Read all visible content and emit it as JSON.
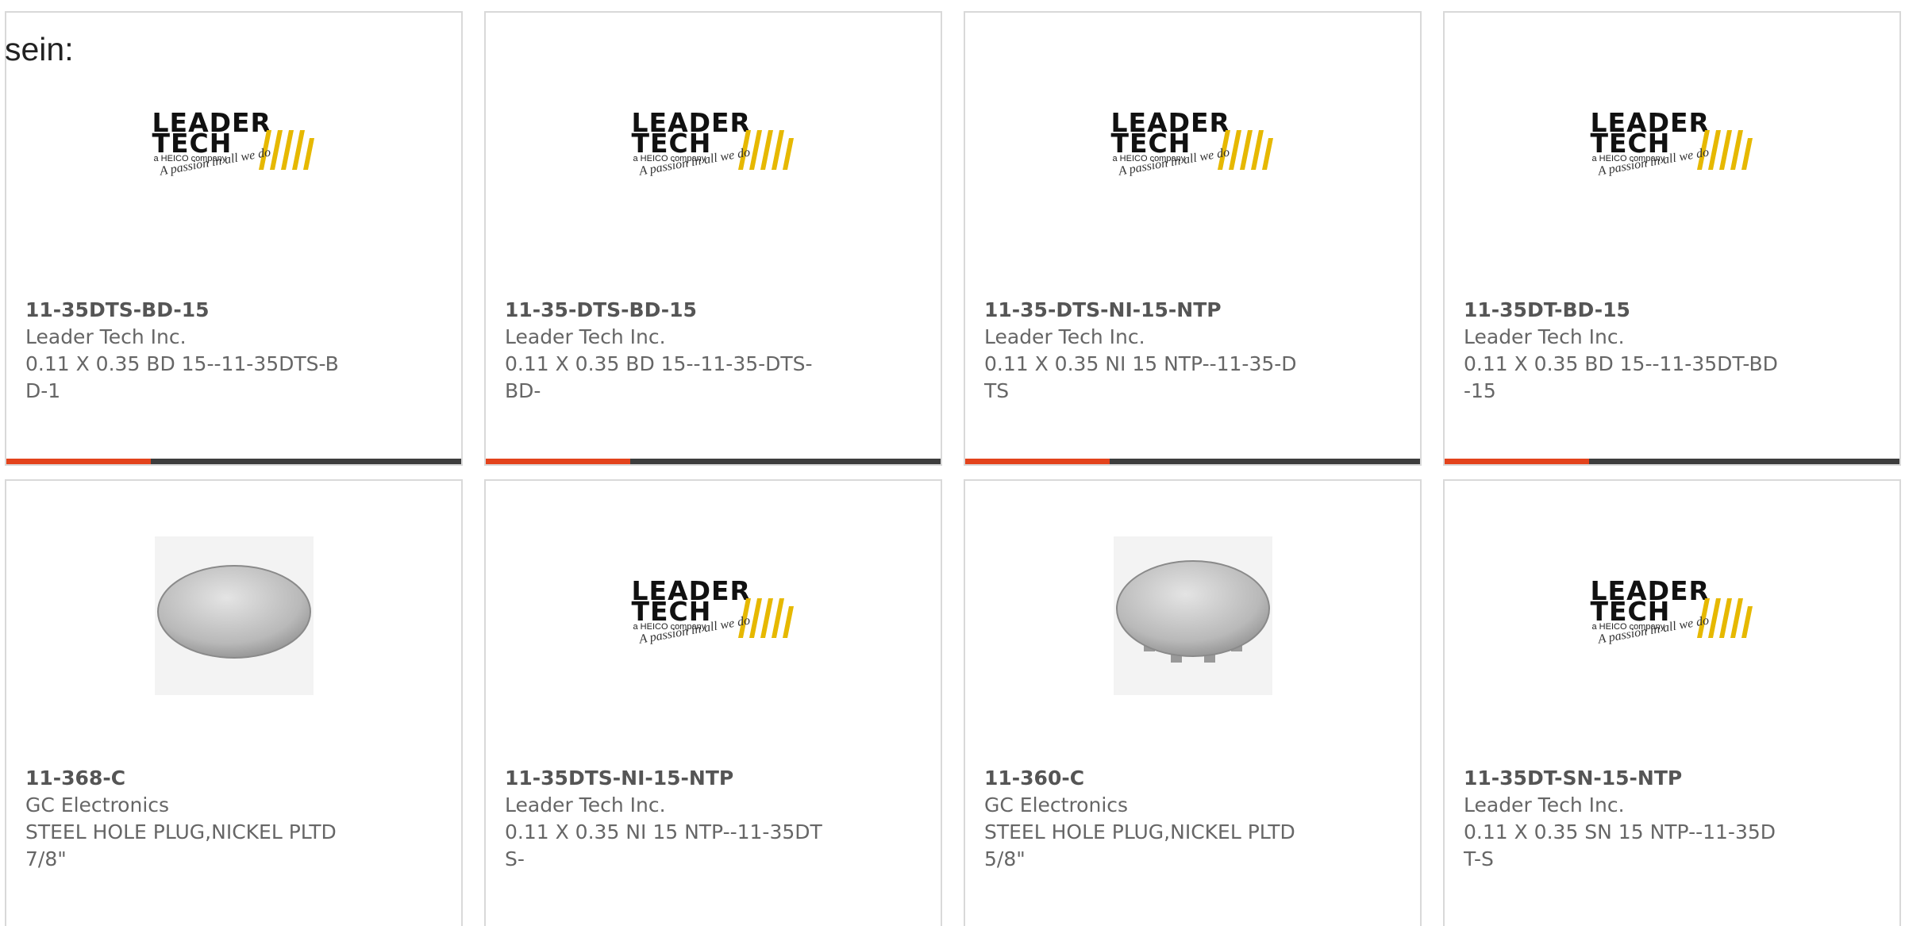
{
  "lead_text": "sein:",
  "products": [
    {
      "image": "leader-tech-logo",
      "part_number": "11-35DTS-BD-15",
      "manufacturer": "Leader Tech Inc.",
      "description": "0.11 X 0.35 BD 15--11-35DTS-BD-1",
      "logo": {
        "word1": "LEADER",
        "word2": "TECH",
        "tagline": "a HEICO company",
        "slogan": "A passion in all we do"
      }
    },
    {
      "image": "leader-tech-logo",
      "part_number": "11-35-DTS-BD-15",
      "manufacturer": "Leader Tech Inc.",
      "description": "0.11 X 0.35 BD 15--11-35-DTS-BD-",
      "logo": {
        "word1": "LEADER",
        "word2": "TECH",
        "tagline": "a HEICO company",
        "slogan": "A passion in all we do"
      }
    },
    {
      "image": "leader-tech-logo",
      "part_number": "11-35-DTS-NI-15-NTP",
      "manufacturer": "Leader Tech Inc.",
      "description": "0.11 X 0.35 NI 15 NTP--11-35-DTS",
      "logo": {
        "word1": "LEADER",
        "word2": "TECH",
        "tagline": "a HEICO company",
        "slogan": "A passion in all we do"
      }
    },
    {
      "image": "leader-tech-logo",
      "part_number": "11-35DT-BD-15",
      "manufacturer": "Leader Tech Inc.",
      "description": "0.11 X 0.35 BD 15--11-35DT-BD-15",
      "logo": {
        "word1": "LEADER",
        "word2": "TECH",
        "tagline": "a HEICO company",
        "slogan": "A passion in all we do"
      }
    },
    {
      "image": "hole-plug-photo",
      "part_number": "11-368-C",
      "manufacturer": "GC Electronics",
      "description": "STEEL HOLE PLUG,NICKEL PLTD 7/8\""
    },
    {
      "image": "leader-tech-logo",
      "part_number": "11-35DTS-NI-15-NTP",
      "manufacturer": "Leader Tech Inc.",
      "description": "0.11 X 0.35 NI 15 NTP--11-35DTS-",
      "logo": {
        "word1": "LEADER",
        "word2": "TECH",
        "tagline": "a HEICO company",
        "slogan": "A passion in all we do"
      }
    },
    {
      "image": "hole-plug-photo",
      "part_number": "11-360-C",
      "manufacturer": "GC Electronics",
      "description": "STEEL HOLE PLUG,NICKEL PLTD 5/8\""
    },
    {
      "image": "leader-tech-logo",
      "part_number": "11-35DT-SN-15-NTP",
      "manufacturer": "Leader Tech Inc.",
      "description": "0.11 X 0.35 SN 15 NTP--11-35DT-S",
      "logo": {
        "word1": "LEADER",
        "word2": "TECH",
        "tagline": "a HEICO company",
        "slogan": "A passion in all we do"
      }
    }
  ],
  "colors": {
    "accent_bar": "#e3431c",
    "bar": "#3d3d3d",
    "logo_yellow": "#e6b800"
  }
}
